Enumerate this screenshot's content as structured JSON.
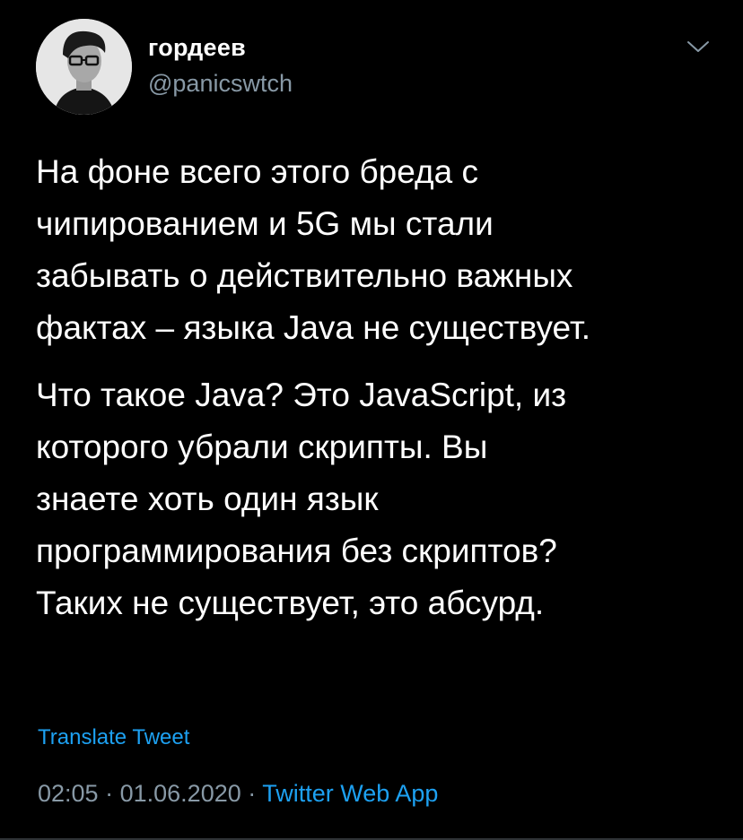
{
  "tweet": {
    "author": {
      "display_name": "гордеев",
      "handle": "@panicswtch"
    },
    "paragraphs": [
      {
        "lines": [
          "На фоне всего этого бреда с",
          "чипированием и 5G мы стали",
          "забывать о действительно важных",
          "фактах – языка Java не существует."
        ]
      },
      {
        "lines": [
          "Что такое Java? Это JavaScript, из",
          "которого убрали скрипты. Вы",
          "знаете хоть один язык",
          "программирования без скриптов?",
          "Таких не существует, это абсурд."
        ]
      }
    ],
    "translate_label": "Translate Tweet",
    "time": "02:05",
    "date": "01.06.2020",
    "separator": "·",
    "source": "Twitter Web App"
  },
  "colors": {
    "background": "#000000",
    "text": "#ffffff",
    "secondary": "#8899a6",
    "accent": "#1da1f2"
  },
  "icons": {
    "menu": "chevron-down-icon"
  }
}
